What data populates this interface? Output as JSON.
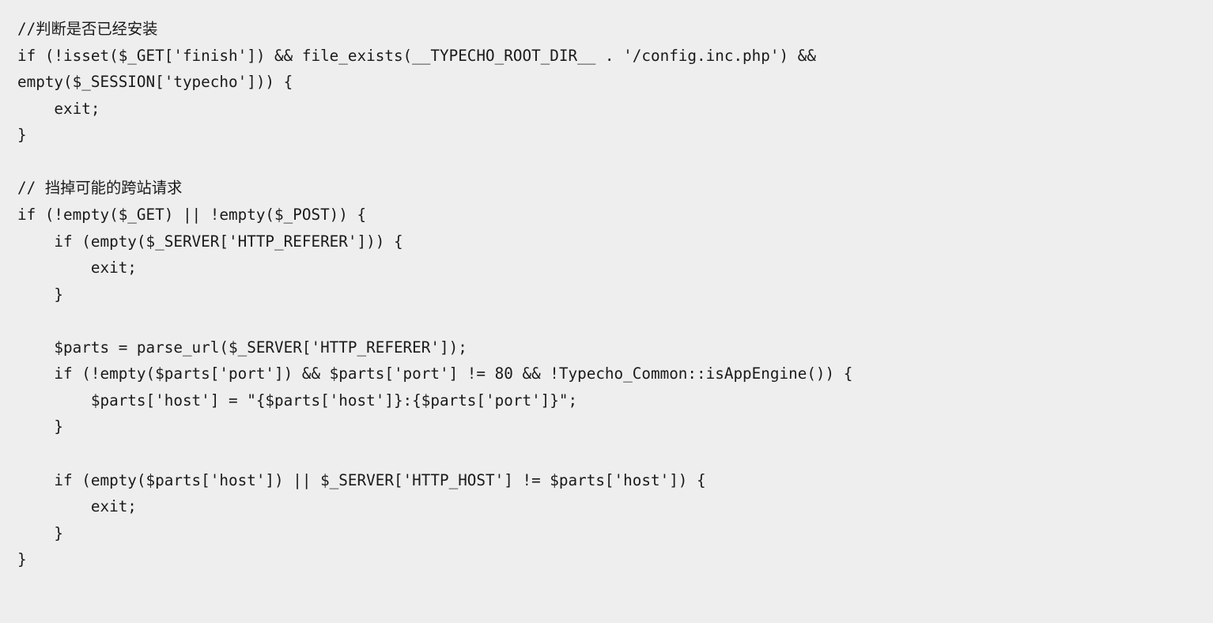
{
  "code": {
    "lines": [
      "//判断是否已经安装",
      "if (!isset($_GET['finish']) && file_exists(__TYPECHO_ROOT_DIR__ . '/config.inc.php') &&",
      "empty($_SESSION['typecho'])) {",
      "    exit;",
      "}",
      "",
      "// 挡掉可能的跨站请求",
      "if (!empty($_GET) || !empty($_POST)) {",
      "    if (empty($_SERVER['HTTP_REFERER'])) {",
      "        exit;",
      "    }",
      "",
      "    $parts = parse_url($_SERVER['HTTP_REFERER']);",
      "    if (!empty($parts['port']) && $parts['port'] != 80 && !Typecho_Common::isAppEngine()) {",
      "        $parts['host'] = \"{$parts['host']}:{$parts['port']}\";",
      "    }",
      "",
      "    if (empty($parts['host']) || $_SERVER['HTTP_HOST'] != $parts['host']) {",
      "        exit;",
      "    }",
      "}"
    ]
  }
}
